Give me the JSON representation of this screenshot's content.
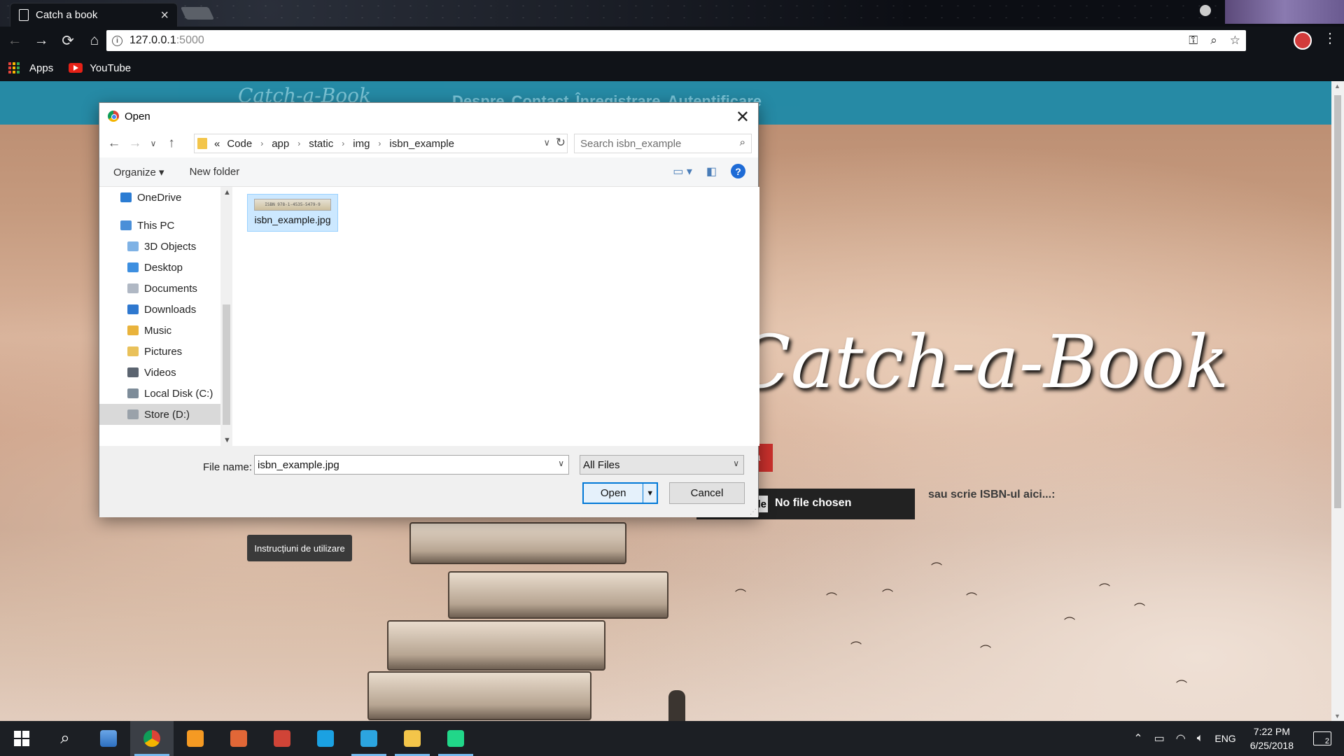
{
  "browser": {
    "tab_title": "Catch a book",
    "tab_close": "×",
    "url_host": "127.0.0.1",
    "url_port": ":5000",
    "bookmarks": [
      {
        "label": "Apps",
        "icon": "apps-grid-icon"
      },
      {
        "label": "YouTube",
        "icon": "youtube-icon"
      }
    ],
    "nav": {
      "back": "←",
      "forward": "→",
      "reload": "⟳",
      "home": "⌂"
    },
    "omnibox_icons": {
      "key": "⚿",
      "zoom": "⌕",
      "star": "☆"
    },
    "menu": "⋮"
  },
  "site": {
    "logo": "Catch-a-Book",
    "nav_links": [
      "Despre",
      "Contact",
      "Înregistrare",
      "Autentificare"
    ],
    "hero_title": "Catch-a-Book",
    "red_button_fragment": "a",
    "choose_file_fragment": "ile",
    "file_status": "No file chosen",
    "isbn_hint": "sau scrie ISBN-ul aici...:",
    "help_button": "Instrucțiuni de utilizare"
  },
  "dialog": {
    "title": "Open",
    "close": "✕",
    "breadcrumb_prefix": "«",
    "breadcrumb": [
      "Code",
      "app",
      "static",
      "img",
      "isbn_example"
    ],
    "search_placeholder": "Search isbn_example",
    "commands": {
      "organize": "Organize ▾",
      "new_folder": "New folder",
      "help": "?"
    },
    "nav_pane": [
      {
        "label": "OneDrive",
        "icon": "cloud-icon",
        "color": "#2b7cd3",
        "level": 0
      },
      {
        "label": "This PC",
        "icon": "computer-icon",
        "color": "#4a8fd8",
        "level": 0
      },
      {
        "label": "3D Objects",
        "icon": "folder-3d-icon",
        "color": "#7fb2e5",
        "level": 1
      },
      {
        "label": "Desktop",
        "icon": "desktop-folder-icon",
        "color": "#3d8fe0",
        "level": 1
      },
      {
        "label": "Documents",
        "icon": "documents-folder-icon",
        "color": "#b0b8c4",
        "level": 1
      },
      {
        "label": "Downloads",
        "icon": "downloads-folder-icon",
        "color": "#2f78cf",
        "level": 1
      },
      {
        "label": "Music",
        "icon": "music-folder-icon",
        "color": "#e9b33c",
        "level": 1
      },
      {
        "label": "Pictures",
        "icon": "pictures-folder-icon",
        "color": "#e9c15a",
        "level": 1
      },
      {
        "label": "Videos",
        "icon": "videos-folder-icon",
        "color": "#5b6470",
        "level": 1
      },
      {
        "label": "Local Disk (C:)",
        "icon": "disk-icon",
        "color": "#7d8c99",
        "level": 1
      },
      {
        "label": "Store (D:)",
        "icon": "drive-icon",
        "color": "#9aa2aa",
        "level": 1,
        "selected": true
      }
    ],
    "file": {
      "name": "isbn_example.jpg",
      "thumb_text": "ISBN 978-1-4535-5479-9"
    },
    "file_name_label": "File name:",
    "file_name_value": "isbn_example.jpg",
    "file_type": "All Files",
    "open_button": "Open",
    "cancel_button": "Cancel"
  },
  "taskbar": {
    "apps": [
      {
        "name": "start-button",
        "icon": "windows-logo-icon"
      },
      {
        "name": "search-button",
        "icon": "search-icon"
      },
      {
        "name": "task-view-button",
        "icon": "desktop-app-icon"
      },
      {
        "name": "chrome-button",
        "icon": "chrome-icon",
        "active": true
      },
      {
        "name": "sublime-button",
        "icon": "sublime-icon",
        "color": "#f59a23"
      },
      {
        "name": "matlab-button",
        "icon": "matlab-icon",
        "color": "#e16737"
      },
      {
        "name": "app-bars-button",
        "icon": "bars-app-icon",
        "color": "#d04437"
      },
      {
        "name": "app-square-button",
        "icon": "square-app-icon",
        "color": "#1ba1e2"
      },
      {
        "name": "telegram-button",
        "icon": "telegram-icon",
        "color": "#2ca5e0"
      },
      {
        "name": "explorer-button",
        "icon": "file-explorer-icon",
        "color": "#f3c54a"
      },
      {
        "name": "pycharm-button",
        "icon": "pycharm-icon",
        "color": "#21d789"
      }
    ],
    "language": "ENG",
    "time": "7:22 PM",
    "date": "6/25/2018",
    "notifications": "2"
  }
}
